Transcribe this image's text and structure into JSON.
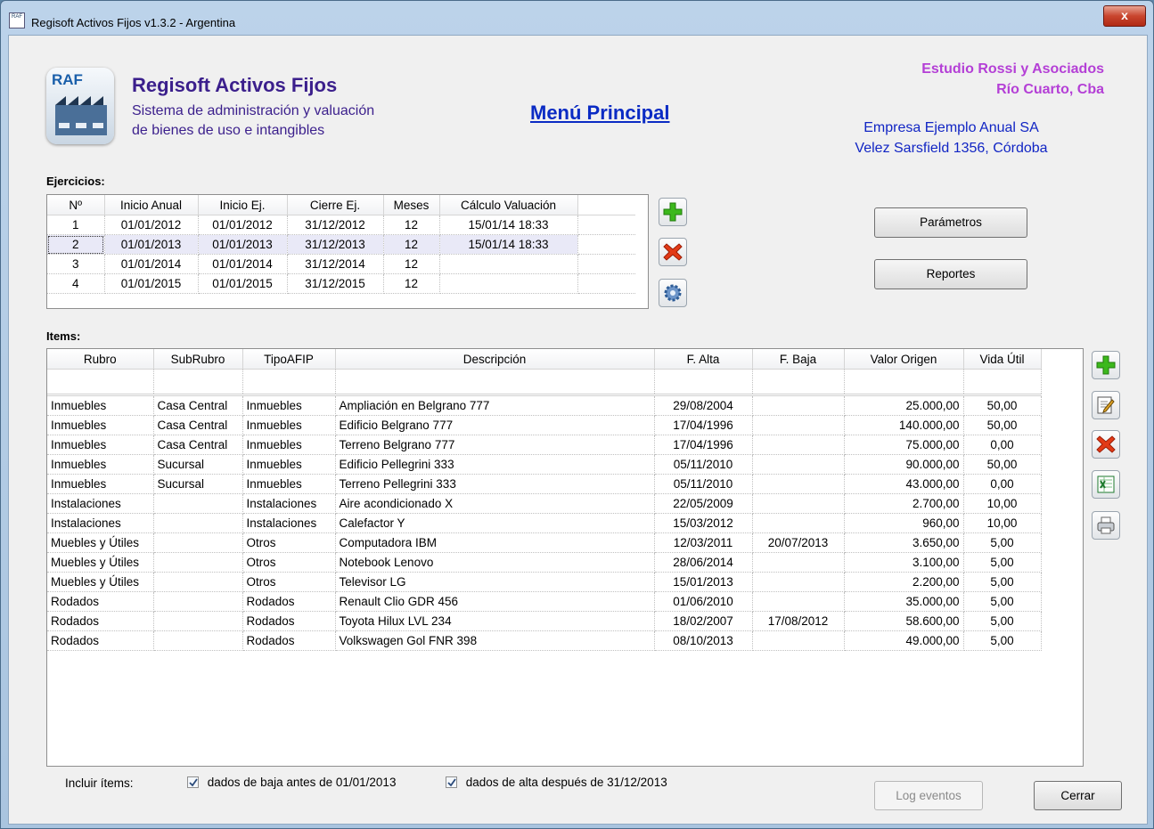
{
  "window": {
    "title": "Regisoft Activos Fijos v1.3.2 - Argentina",
    "close_glyph": "x",
    "app_icon_text": "RAF"
  },
  "header": {
    "logo_text": "RAF",
    "app_name": "Regisoft Activos Fijos",
    "subtitle_line1": "Sistema de administración y valuación",
    "subtitle_line2": "de bienes de uso e intangibles",
    "menu_title": "Menú Principal",
    "estudio_name": "Estudio Rossi y Asociados",
    "estudio_location": "Río Cuarto, Cba",
    "empresa_name": "Empresa Ejemplo Anual SA",
    "empresa_address": "Velez Sarsfield 1356, Córdoba"
  },
  "ejercicios": {
    "label": "Ejercicios:",
    "columns": [
      "Nº",
      "Inicio Anual",
      "Inicio Ej.",
      "Cierre Ej.",
      "Meses",
      "Cálculo Valuación"
    ],
    "rows": [
      [
        "1",
        "01/01/2012",
        "01/01/2012",
        "31/12/2012",
        "12",
        "15/01/14  18:33"
      ],
      [
        "2",
        "01/01/2013",
        "01/01/2013",
        "31/12/2013",
        "12",
        "15/01/14  18:33"
      ],
      [
        "3",
        "01/01/2014",
        "01/01/2014",
        "31/12/2014",
        "12",
        ""
      ],
      [
        "4",
        "01/01/2015",
        "01/01/2015",
        "31/12/2015",
        "12",
        ""
      ]
    ],
    "selected_row": 1
  },
  "buttons": {
    "parametros": "Parámetros",
    "reportes": "Reportes",
    "log_eventos": "Log eventos",
    "cerrar": "Cerrar"
  },
  "items": {
    "label": "Items:",
    "columns": [
      "Rubro",
      "SubRubro",
      "TipoAFIP",
      "Descripción",
      "F. Alta",
      "F. Baja",
      "Valor Origen",
      "Vida Útil"
    ],
    "rows": [
      [
        "Inmuebles",
        "Casa Central",
        "Inmuebles",
        "Ampliación en Belgrano 777",
        "29/08/2004",
        "",
        "25.000,00",
        "50,00"
      ],
      [
        "Inmuebles",
        "Casa Central",
        "Inmuebles",
        "Edificio Belgrano 777",
        "17/04/1996",
        "",
        "140.000,00",
        "50,00"
      ],
      [
        "Inmuebles",
        "Casa Central",
        "Inmuebles",
        "Terreno Belgrano 777",
        "17/04/1996",
        "",
        "75.000,00",
        "0,00"
      ],
      [
        "Inmuebles",
        "Sucursal",
        "Inmuebles",
        "Edificio Pellegrini 333",
        "05/11/2010",
        "",
        "90.000,00",
        "50,00"
      ],
      [
        "Inmuebles",
        "Sucursal",
        "Inmuebles",
        "Terreno Pellegrini 333",
        "05/11/2010",
        "",
        "43.000,00",
        "0,00"
      ],
      [
        "Instalaciones",
        "",
        "Instalaciones",
        "Aire acondicionado X",
        "22/05/2009",
        "",
        "2.700,00",
        "10,00"
      ],
      [
        "Instalaciones",
        "",
        "Instalaciones",
        "Calefactor Y",
        "15/03/2012",
        "",
        "960,00",
        "10,00"
      ],
      [
        "Muebles y Útiles",
        "",
        "Otros",
        "Computadora IBM",
        "12/03/2011",
        "20/07/2013",
        "3.650,00",
        "5,00"
      ],
      [
        "Muebles y Útiles",
        "",
        "Otros",
        "Notebook Lenovo",
        "28/06/2014",
        "",
        "3.100,00",
        "5,00"
      ],
      [
        "Muebles y Útiles",
        "",
        "Otros",
        "Televisor LG",
        "15/01/2013",
        "",
        "2.200,00",
        "5,00"
      ],
      [
        "Rodados",
        "",
        "Rodados",
        "Renault Clio GDR 456",
        "01/06/2010",
        "",
        "35.000,00",
        "5,00"
      ],
      [
        "Rodados",
        "",
        "Rodados",
        "Toyota Hilux LVL 234",
        "18/02/2007",
        "17/08/2012",
        "58.600,00",
        "5,00"
      ],
      [
        "Rodados",
        "",
        "Rodados",
        "Volkswagen Gol FNR 398",
        "08/10/2013",
        "",
        "49.000,00",
        "5,00"
      ]
    ]
  },
  "footer": {
    "incluir_label": "Incluir ítems:",
    "check_baja_label": "dados de baja antes de 01/01/2013",
    "check_alta_label": "dados de alta después de 31/12/2013"
  },
  "colors": {
    "app_name": "#3b1f8c",
    "menu_title": "#0a2bc4",
    "estudio": "#b43fd6",
    "empresa": "#1125c4"
  },
  "icons": {
    "add": "plus-icon",
    "delete": "x-icon",
    "settings": "gear-icon",
    "edit": "edit-icon",
    "excel": "excel-icon",
    "print": "printer-icon"
  }
}
